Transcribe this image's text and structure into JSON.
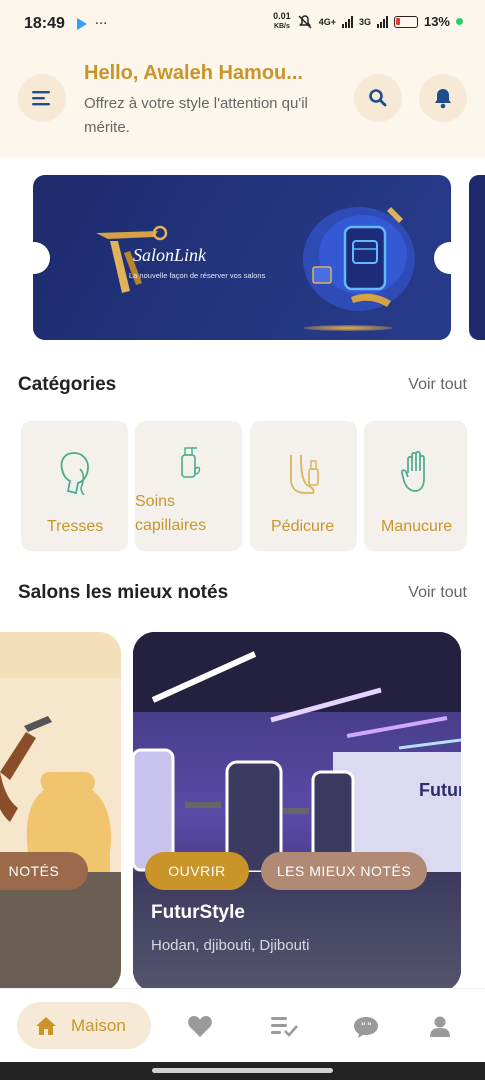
{
  "status_bar": {
    "time": "18:49",
    "more": "···",
    "speed_value": "0.01",
    "speed_unit": "KB/s",
    "net1": "4G+",
    "net2": "3G",
    "battery": "13%"
  },
  "header": {
    "greeting": "Hello, Awaleh Hamou...",
    "subtitle": "Offrez à votre style l'attention qu'il mérite."
  },
  "banner": {
    "brand": "SalonLink",
    "tagline": "La nouvelle façon de réserver vos salons"
  },
  "categories": {
    "title": "Catégories",
    "see_all": "Voir tout",
    "items": [
      {
        "label": "Tresses",
        "icon": "braid-head-icon"
      },
      {
        "label": "Soins capillaires",
        "icon": "hair-care-bottle-icon"
      },
      {
        "label": "Pédicure",
        "icon": "foot-polish-icon"
      },
      {
        "label": "Manucure",
        "icon": "hand-icon"
      }
    ]
  },
  "salons": {
    "title": "Salons les mieux notés",
    "see_all": "Voir tout",
    "left_badge": "NOTÉS",
    "card": {
      "name": "FuturStyle",
      "location": "Hodan, djibouti, Djibouti",
      "badge_open": "OUVRIR",
      "badge_top": "LES MIEUX NOTÉS",
      "sign_text": "FuturS"
    }
  },
  "bottom_nav": {
    "home_label": "Maison",
    "items": [
      "heart-icon",
      "list-check-icon",
      "chat-icon",
      "profile-icon"
    ]
  },
  "colors": {
    "accent": "#c9952b",
    "header_bg": "#fdf6ec",
    "banner_bg": "#22347d"
  }
}
